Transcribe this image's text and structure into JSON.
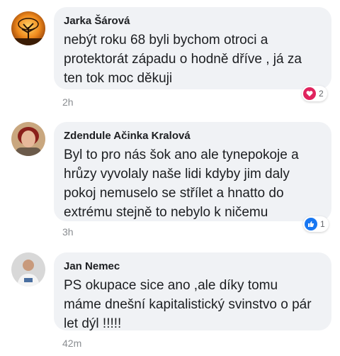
{
  "comments": [
    {
      "author": "Jarka Šárová",
      "text": "nebýt roku 68 byli bychom otroci a\nprotektorát západu o hodně dříve , já za\nten tok moc děkuji",
      "time": "2h",
      "reaction_icon": "love-icon",
      "reaction_count": "2",
      "reaction_color": "#e0245e",
      "avatar_icon": "tree-sunset-avatar"
    },
    {
      "author": "Zdendule Ačinka Kralová",
      "text": "Byl to pro nás šok ano ale tynepokoje a\nhrůzy vyvolaly naše lidi  kdyby jim daly\npokoj nemuselo se střílet a hnatto do\nextrému stejně to nebylo k ničemu",
      "time": "3h",
      "reaction_icon": "like-icon",
      "reaction_count": "1",
      "reaction_color": "#1877f2",
      "avatar_icon": "woman-portrait-avatar"
    },
    {
      "author": "Jan Nemec",
      "text": "PS okupace sice ano ,ale díky tomu\nmáme dnešní kapitalistický svinstvo o pár\nlet dýl !!!!!",
      "time": "42m",
      "avatar_icon": "man-portrait-avatar"
    }
  ]
}
